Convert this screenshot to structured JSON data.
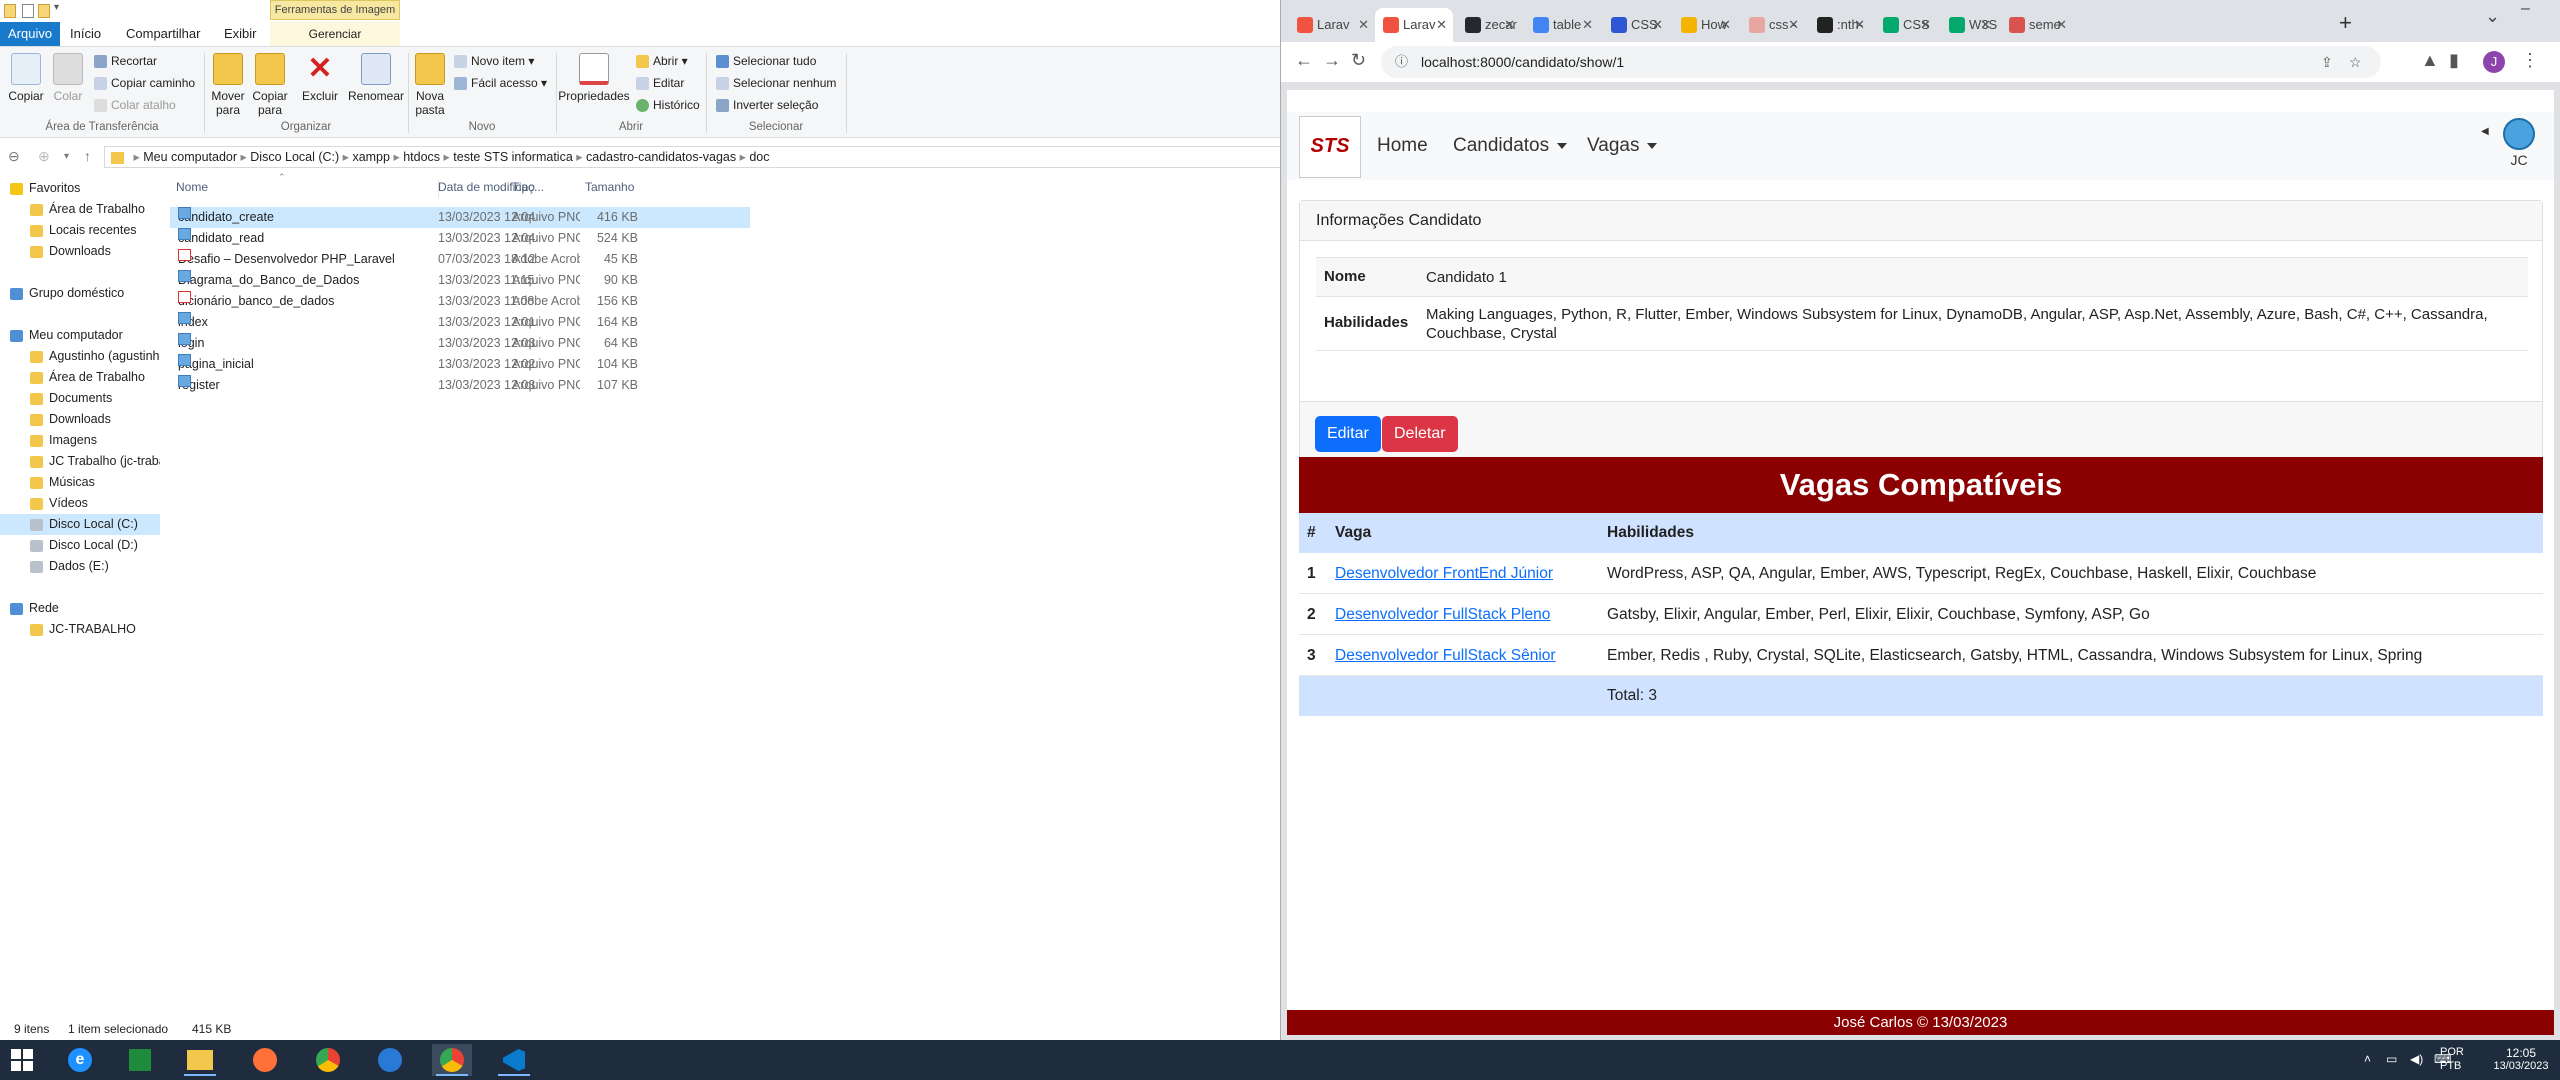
{
  "explorer": {
    "context_tab": "Ferramentas de Imagem",
    "tabs": [
      "Arquivo",
      "Início",
      "Compartilhar",
      "Exibir"
    ],
    "context_subtab": "Gerenciar",
    "ribbon": {
      "clipboard": {
        "copiar": "Copiar",
        "colar": "Colar",
        "recortar": "Recortar",
        "copiar_caminho": "Copiar caminho",
        "colar_atalho": "Colar atalho",
        "group": "Área de Transferência"
      },
      "organizar": {
        "mover": "Mover",
        "mover2": "para",
        "copiar": "Copiar",
        "copiar2": "para",
        "excluir": "Excluir",
        "renomear": "Renomear",
        "group": "Organizar"
      },
      "novo": {
        "nova_pasta": "Nova",
        "nova_pasta2": "pasta",
        "novo_item": "Novo item",
        "facil_acesso": "Fácil acesso",
        "group": "Novo"
      },
      "abrir": {
        "propriedades": "Propriedades",
        "abrir": "Abrir",
        "editar": "Editar",
        "historico": "Histórico",
        "group": "Abrir"
      },
      "selecionar": {
        "tudo": "Selecionar tudo",
        "nenhum": "Selecionar nenhum",
        "inverter": "Inverter seleção",
        "group": "Selecionar"
      }
    },
    "breadcrumb": [
      "Meu computador",
      "Disco Local (C:)",
      "xampp",
      "htdocs",
      "teste STS informatica",
      "cadastro-candidatos-vagas",
      "doc"
    ],
    "columns": {
      "name": "Nome",
      "date": "Data de modificaç...",
      "type": "Tipo",
      "size": "Tamanho"
    },
    "nav": [
      {
        "label": "Favoritos",
        "indent": 0
      },
      {
        "label": "Área de Trabalho",
        "indent": 1
      },
      {
        "label": "Locais recentes",
        "indent": 1
      },
      {
        "label": "Downloads",
        "indent": 1
      },
      {
        "label": "",
        "indent": 0
      },
      {
        "label": "Grupo doméstico",
        "indent": 0
      },
      {
        "label": "",
        "indent": 0
      },
      {
        "label": "Meu computador",
        "indent": 0
      },
      {
        "label": "Agustinho (agustinh",
        "indent": 1
      },
      {
        "label": "Área de Trabalho",
        "indent": 1
      },
      {
        "label": "Documents",
        "indent": 1
      },
      {
        "label": "Downloads",
        "indent": 1
      },
      {
        "label": "Imagens",
        "indent": 1
      },
      {
        "label": "JC Trabalho (jc-traba",
        "indent": 1
      },
      {
        "label": "Músicas",
        "indent": 1
      },
      {
        "label": "Vídeos",
        "indent": 1
      },
      {
        "label": "Disco Local (C:)",
        "indent": 1
      },
      {
        "label": "Disco Local (D:)",
        "indent": 1
      },
      {
        "label": "Dados (E:)",
        "indent": 1
      },
      {
        "label": "",
        "indent": 0
      },
      {
        "label": "Rede",
        "indent": 0
      },
      {
        "label": "JC-TRABALHO",
        "indent": 1
      }
    ],
    "files": [
      {
        "name": "candidato_create",
        "date": "13/03/2023 12:04",
        "type": "Arquivo PNG",
        "size": "416 KB",
        "kind": "png"
      },
      {
        "name": "candidato_read",
        "date": "13/03/2023 12:04",
        "type": "Arquivo PNG",
        "size": "524 KB",
        "kind": "png"
      },
      {
        "name": "Desafio – Desenvolvedor PHP_Laravel",
        "date": "07/03/2023 18:12",
        "type": "Adobe Acrobat D...",
        "size": "45 KB",
        "kind": "pdf"
      },
      {
        "name": "Diagrama_do_Banco_de_Dados",
        "date": "13/03/2023 11:15",
        "type": "Arquivo PNG",
        "size": "90 KB",
        "kind": "png"
      },
      {
        "name": "dicionário_banco_de_dados",
        "date": "13/03/2023 11:08",
        "type": "Adobe Acrobat D...",
        "size": "156 KB",
        "kind": "pdf"
      },
      {
        "name": "index",
        "date": "13/03/2023 12:01",
        "type": "Arquivo PNG",
        "size": "164 KB",
        "kind": "png"
      },
      {
        "name": "login",
        "date": "13/03/2023 12:03",
        "type": "Arquivo PNG",
        "size": "64 KB",
        "kind": "png"
      },
      {
        "name": "pagina_inicial",
        "date": "13/03/2023 12:02",
        "type": "Arquivo PNG",
        "size": "104 KB",
        "kind": "png"
      },
      {
        "name": "register",
        "date": "13/03/2023 12:03",
        "type": "Arquivo PNG",
        "size": "107 KB",
        "kind": "png"
      }
    ],
    "status": {
      "count": "9 itens",
      "selected": "1 item selecionado",
      "size": "415 KB"
    }
  },
  "browser": {
    "tabs": [
      {
        "label": "Larav",
        "color": "#f05340"
      },
      {
        "label": "Larav",
        "color": "#f05340"
      },
      {
        "label": "zecar",
        "color": "#24292f"
      },
      {
        "label": "table",
        "color": "#4285f4"
      },
      {
        "label": "CSS",
        "color": "#2e57d4"
      },
      {
        "label": "How",
        "color": "#f4b400"
      },
      {
        "label": "css -",
        "color": "#e8a6a0"
      },
      {
        "label": ":nth-",
        "color": "#222222"
      },
      {
        "label": "CSS",
        "color": "#04aa6d"
      },
      {
        "label": "W3Sc",
        "color": "#04aa6d"
      },
      {
        "label": "seme",
        "color": "#d9534f"
      }
    ],
    "url": "localhost:8000/candidato/show/1",
    "avatar_letter": "J"
  },
  "app": {
    "brand": "STS",
    "nav": {
      "home": "Home",
      "candidatos": "Candidatos",
      "vagas": "Vagas"
    },
    "user": "JC",
    "card_title": "Informações Candidato",
    "nome_label": "Nome",
    "nome_value": "Candidato 1",
    "hab_label": "Habilidades",
    "hab_value": "Making Languages, Python, R, Flutter, Ember, Windows Subsystem for Linux, DynamoDB, Angular, ASP, Asp.Net, Assembly, Azure, Bash, C#, C++, Cassandra, Couchbase, Crystal",
    "edit_btn": "Editar",
    "delete_btn": "Deletar",
    "vagas_title": "Vagas Compatíveis",
    "table_headers": {
      "num": "#",
      "vaga": "Vaga",
      "hab": "Habilidades"
    },
    "vagas": [
      {
        "num": "1",
        "vaga": "Desenvolvedor FrontEnd Júnior",
        "hab": "WordPress, ASP, QA, Angular, Ember, AWS, Typescript, RegEx, Couchbase, Haskell, Elixir, Couchbase"
      },
      {
        "num": "2",
        "vaga": "Desenvolvedor FullStack Pleno",
        "hab": "Gatsby, Elixir, Angular, Ember, Perl, Elixir, Elixir, Couchbase, Symfony, ASP, Go"
      },
      {
        "num": "3",
        "vaga": "Desenvolvedor FullStack Sênior",
        "hab": "Ember, Redis , Ruby, Crystal, SQLite, Elasticsearch, Gatsby, HTML, Cassandra, Windows Subsystem for Linux, Spring"
      }
    ],
    "total": "Total: 3",
    "footer": "José Carlos © 13/03/2023"
  },
  "taskbar": {
    "lang1": "POR",
    "lang2": "PTB",
    "time": "12:05",
    "date": "13/03/2023"
  }
}
